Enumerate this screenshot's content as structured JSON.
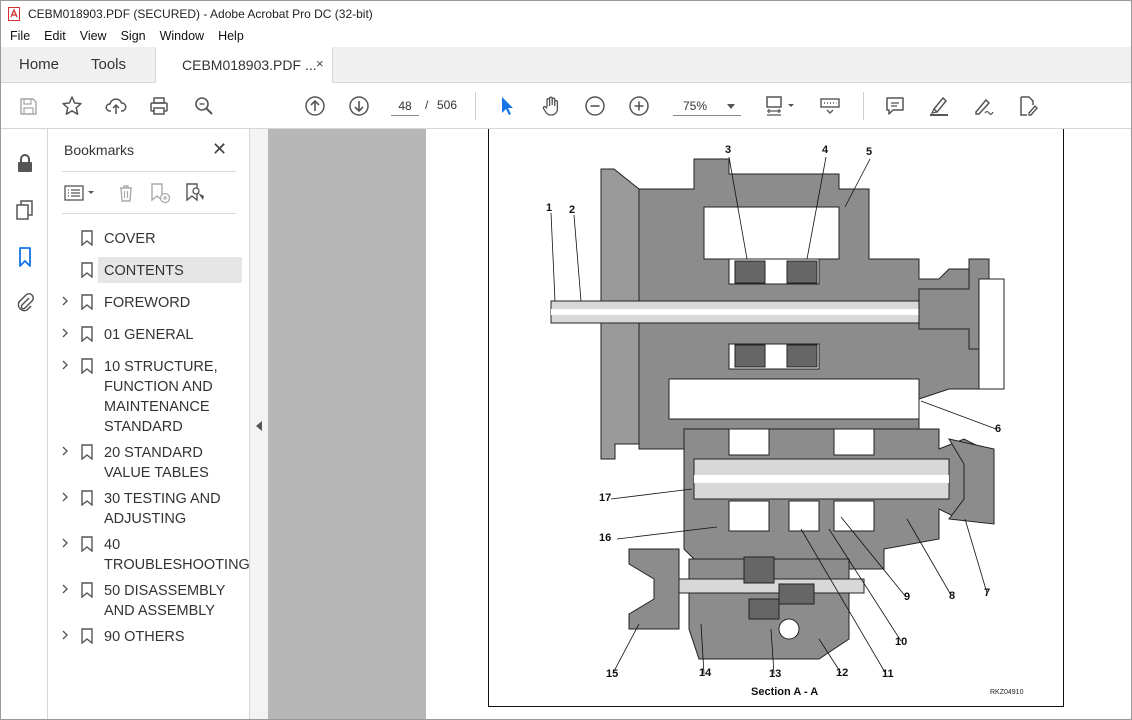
{
  "window": {
    "title": "CEBM018903.PDF (SECURED) - Adobe Acrobat Pro DC (32-bit)"
  },
  "menu": [
    "File",
    "Edit",
    "View",
    "Sign",
    "Window",
    "Help"
  ],
  "tabs": {
    "home": "Home",
    "tools": "Tools",
    "document": "CEBM018903.PDF ...",
    "close": "×"
  },
  "toolbar": {
    "current_page": "48",
    "page_separator": "/",
    "total_pages": "506",
    "zoom": "75%"
  },
  "bookmarks": {
    "title": "Bookmarks",
    "close": "✕",
    "items": [
      {
        "label": "COVER",
        "expandable": false,
        "selected": false
      },
      {
        "label": "CONTENTS",
        "expandable": false,
        "selected": true
      },
      {
        "label": "FOREWORD",
        "expandable": true,
        "selected": false
      },
      {
        "label": "01 GENERAL",
        "expandable": true,
        "selected": false
      },
      {
        "label": "10 STRUCTURE,\nFUNCTION AND\nMAINTENANCE\nSTANDARD",
        "expandable": true,
        "selected": false
      },
      {
        "label": "20 STANDARD\nVALUE TABLES",
        "expandable": true,
        "selected": false
      },
      {
        "label": "30 TESTING AND\nADJUSTING",
        "expandable": true,
        "selected": false
      },
      {
        "label": "40\nTROUBLESHOOTING",
        "expandable": true,
        "selected": false
      },
      {
        "label": "50 DISASSEMBLY\nAND ASSEMBLY",
        "expandable": true,
        "selected": false
      },
      {
        "label": "90 OTHERS",
        "expandable": true,
        "selected": false
      }
    ]
  },
  "document": {
    "callouts": [
      "1",
      "2",
      "3",
      "4",
      "5",
      "6",
      "7",
      "8",
      "9",
      "10",
      "11",
      "12",
      "13",
      "14",
      "15",
      "16",
      "17"
    ],
    "section_label": "Section A - A",
    "figure_code": "RKZ04910"
  },
  "colors": {
    "accent": "#1473e6",
    "icon_gray": "#555555",
    "panel_selected": "#e6e6e6",
    "doc_background": "#b7b7b7",
    "diagram_fill": "#8c8c8c"
  },
  "icons": {
    "toolbar": [
      "save-icon",
      "star-icon",
      "upload-icon",
      "print-icon",
      "zoom-search-icon",
      "page-up-icon",
      "page-down-icon",
      "select-arrow-icon",
      "hand-icon",
      "zoom-out-icon",
      "zoom-in-icon",
      "fit-page-icon",
      "keyboard-icon",
      "comment-icon",
      "highlight-icon",
      "sign-icon",
      "edit-pdf-icon"
    ],
    "rail": [
      "lock-icon",
      "pages-icon",
      "bookmark-icon",
      "attachment-icon"
    ]
  }
}
